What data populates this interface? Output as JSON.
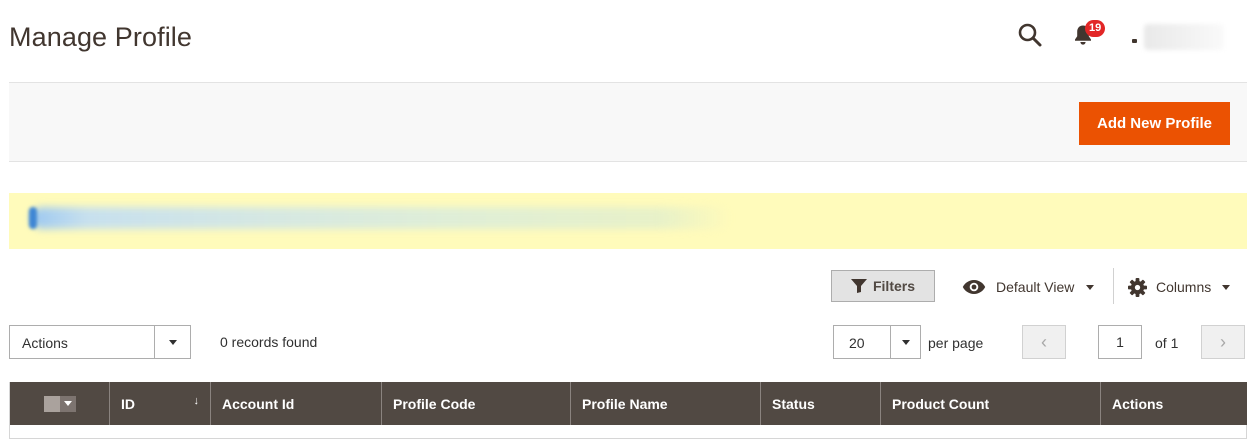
{
  "page": {
    "title": "Manage Profile"
  },
  "header": {
    "notifications_count": "19",
    "icons": {
      "search": "search-icon",
      "notifications": "bell-icon"
    }
  },
  "actions_bar": {
    "add_button_label": "Add New Profile"
  },
  "toolbar": {
    "filters_label": "Filters",
    "view_label": "Default View",
    "columns_label": "Columns",
    "mass_actions_label": "Actions",
    "records_found": "0 records found",
    "per_page_value": "20",
    "per_page_label": "per page",
    "current_page": "1",
    "page_total": "of 1",
    "prev_glyph": "‹",
    "next_glyph": "›"
  },
  "grid": {
    "columns": [
      "ID",
      "Account Id",
      "Profile Code",
      "Profile Name",
      "Status",
      "Product Count",
      "Actions"
    ],
    "sort_indicator": "↓",
    "rows": []
  },
  "colors": {
    "accent": "#eb5202",
    "grid_header": "#514943",
    "message_bg": "#fffbbb",
    "badge": "#e22626"
  }
}
